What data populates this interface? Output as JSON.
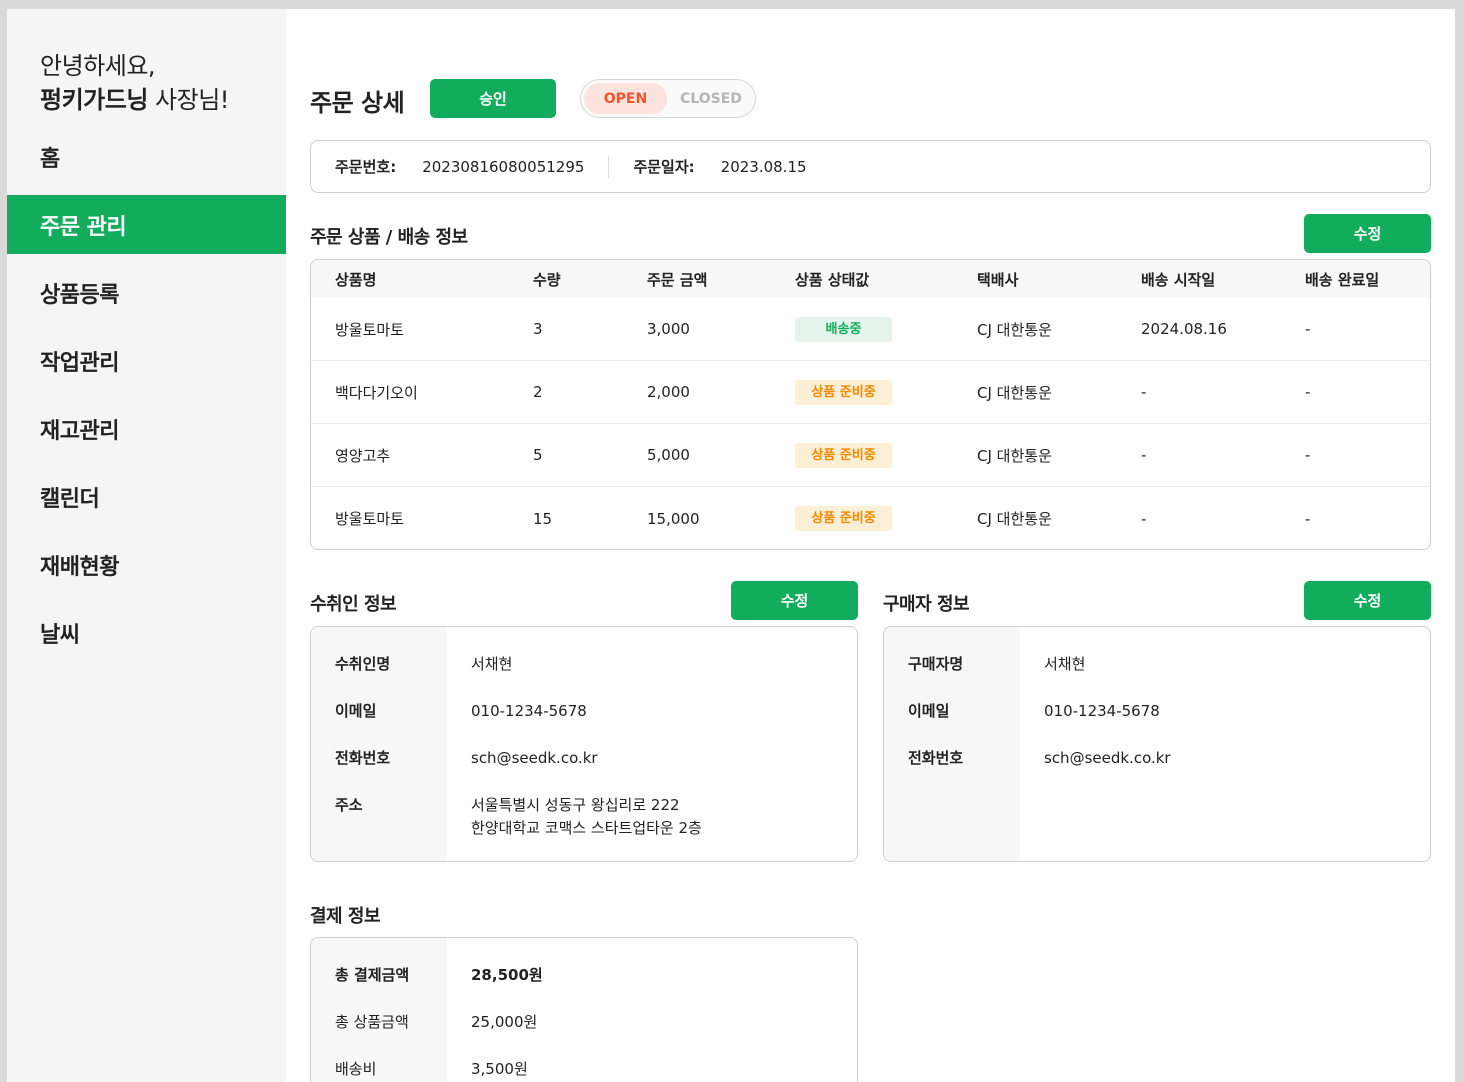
{
  "sidebar": {
    "greeting_line1": "안녕하세요,",
    "greeting_name": "펑키가드닝",
    "greeting_suffix": " 사장님!",
    "items": [
      {
        "label": "홈"
      },
      {
        "label": "주문 관리"
      },
      {
        "label": "상품등록"
      },
      {
        "label": "작업관리"
      },
      {
        "label": "재고관리"
      },
      {
        "label": "캘린더"
      },
      {
        "label": "재배현황"
      },
      {
        "label": "날씨"
      }
    ],
    "active_item": "주문 관리"
  },
  "header": {
    "title": "주문 상세",
    "approve_label": "승인",
    "toggle_open": "OPEN",
    "toggle_closed": "CLOSED",
    "toggle_selected": "OPEN"
  },
  "order": {
    "number_label": "주문번호:",
    "number": "20230816080051295",
    "date_label": "주문일자:",
    "date": "2023.08.15"
  },
  "products": {
    "title": "주문 상품 / 배송 정보",
    "edit_label": "수정",
    "columns": [
      "상품명",
      "수량",
      "주문 금액",
      "상품 상태값",
      "택배사",
      "배송 시작일",
      "배송 완료일"
    ],
    "rows": [
      {
        "name": "방울토마토",
        "qty": "3",
        "amount": "3,000",
        "status": "배송중",
        "courier": "CJ 대한통운",
        "start": "2024.08.16",
        "end": "-"
      },
      {
        "name": "백다다기오이",
        "qty": "2",
        "amount": "2,000",
        "status": "상품 준비중",
        "courier": "CJ 대한통운",
        "start": "-",
        "end": "-"
      },
      {
        "name": "영양고추",
        "qty": "5",
        "amount": "5,000",
        "status": "상품 준비중",
        "courier": "CJ 대한통운",
        "start": "-",
        "end": "-"
      },
      {
        "name": "방울토마토",
        "qty": "15",
        "amount": "15,000",
        "status": "상품 준비중",
        "courier": "CJ 대한통운",
        "start": "-",
        "end": "-"
      }
    ]
  },
  "recipient": {
    "title": "수취인 정보",
    "edit_label": "수정",
    "name_label": "수취인명",
    "name": "서채현",
    "email_label": "이메일",
    "email": "010-1234-5678",
    "phone_label": "전화번호",
    "phone": "sch@seedk.co.kr",
    "address_label": "주소",
    "address_line1": "서울특별시 성동구 왕십리로 222",
    "address_line2": "한양대학교 코맥스 스타트업타운 2층"
  },
  "buyer": {
    "title": "구매자 정보",
    "edit_label": "수정",
    "name_label": "구매자명",
    "name": "서채현",
    "email_label": "이메일",
    "email": "010-1234-5678",
    "phone_label": "전화번호",
    "phone": "sch@seedk.co.kr"
  },
  "payment": {
    "title": "결제 정보",
    "total_label": "총 결제금액",
    "total": "28,500원",
    "product_total_label": "총 상품금액",
    "product_total": "25,000원",
    "shipping_label": "배송비",
    "shipping": "3,500원"
  },
  "colors": {
    "brand_green": "#12ad5c",
    "open_red": "#f0542d",
    "badge_orange": "#f08a00"
  }
}
